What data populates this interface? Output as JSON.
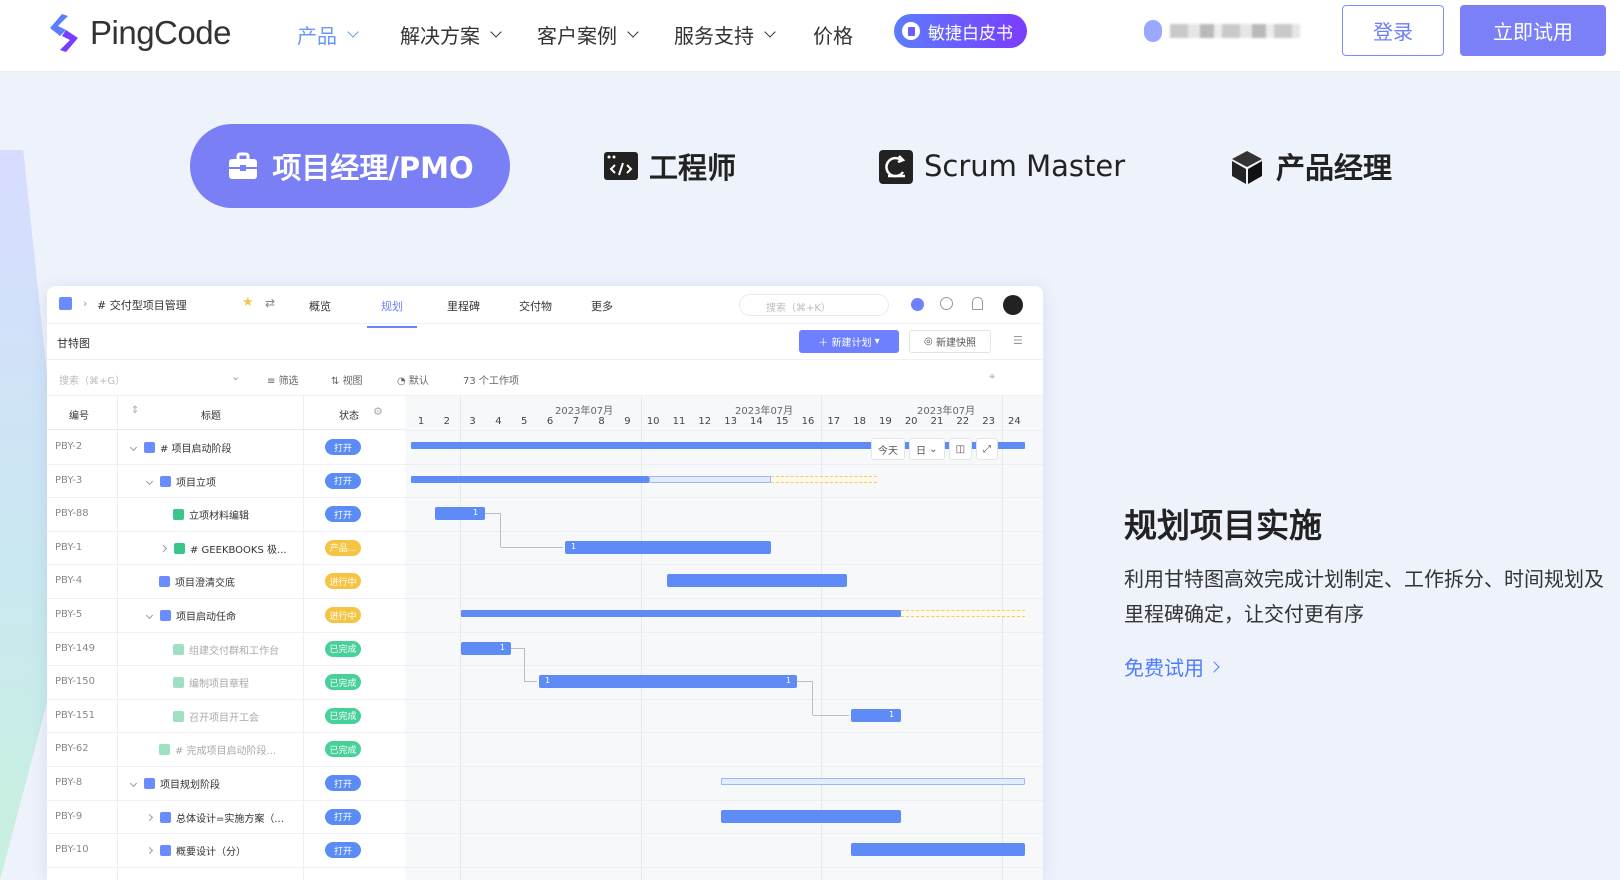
{
  "nav": {
    "logo": "PingCode",
    "items": [
      "产品",
      "解决方案",
      "客户案例",
      "服务支持",
      "价格"
    ],
    "whitepaper": "敏捷白皮书",
    "login": "登录",
    "trial": "立即试用"
  },
  "roles": [
    {
      "label": "项目经理/PMO",
      "icon": "briefcase-icon"
    },
    {
      "label": "工程师",
      "icon": "code-window-icon"
    },
    {
      "label": "Scrum Master",
      "icon": "cycle-icon"
    },
    {
      "label": "产品经理",
      "icon": "cube-icon"
    }
  ],
  "card": {
    "breadcrumb": "# 交付型项目管理",
    "tabs": [
      "概览",
      "规划",
      "里程碑",
      "交付物",
      "更多"
    ],
    "search_placeholder": "搜索（⌘+K）",
    "view_title": "甘特图",
    "new_plan": "新建计划",
    "new_snapshot": "新建快照",
    "filter_placeholder": "搜索（⌘+G）",
    "filter": "筛选",
    "view": "视图",
    "default": "默认",
    "count": "73 个工作项",
    "col_code": "编号",
    "col_title": "标题",
    "col_status": "状态",
    "today": "今天",
    "day_mode": "日",
    "month_label": "2023年07月",
    "days": [
      "1",
      "2",
      "3",
      "4",
      "5",
      "6",
      "7",
      "8",
      "9",
      "10",
      "11",
      "12",
      "13",
      "14",
      "15",
      "16",
      "17",
      "18",
      "19",
      "20",
      "21",
      "22",
      "23",
      "24"
    ],
    "rows": [
      {
        "code": "PBY-2",
        "title": "# 项目启动阶段",
        "status": "打开"
      },
      {
        "code": "PBY-3",
        "title": "项目立项",
        "status": "打开"
      },
      {
        "code": "PBY-88",
        "title": "立项材料编辑",
        "status": "打开"
      },
      {
        "code": "PBY-1",
        "title": "# GEEKBOOKS 极...",
        "status": "产品..."
      },
      {
        "code": "PBY-4",
        "title": "项目澄清交底",
        "status": "进行中"
      },
      {
        "code": "PBY-5",
        "title": "项目启动任命",
        "status": "进行中"
      },
      {
        "code": "PBY-149",
        "title": "组建交付群和工作台",
        "status": "已完成"
      },
      {
        "code": "PBY-150",
        "title": "编制项目章程",
        "status": "已完成"
      },
      {
        "code": "PBY-151",
        "title": "召开项目开工会",
        "status": "已完成"
      },
      {
        "code": "PBY-62",
        "title": "# 完成项目启动阶段...",
        "status": "已完成"
      },
      {
        "code": "PBY-8",
        "title": "项目规划阶段",
        "status": "打开"
      },
      {
        "code": "PBY-9",
        "title": "总体设计=实施方案（...",
        "status": "打开"
      },
      {
        "code": "PBY-10",
        "title": "概要设计（分）",
        "status": "打开"
      }
    ],
    "bar_labels": {
      "one": "1"
    }
  },
  "feature": {
    "title": "规划项目实施",
    "desc": "利用甘特图高效完成计划制定、工作拆分、时间规划及里程碑确定，让交付更有序",
    "link": "免费试用"
  },
  "colors": {
    "accent": "#7a7ff6",
    "bar": "#5e8bf5",
    "open": "#5b8cf5",
    "in_progress": "#f6c444",
    "done": "#48d09a",
    "product": "#f6c444"
  }
}
